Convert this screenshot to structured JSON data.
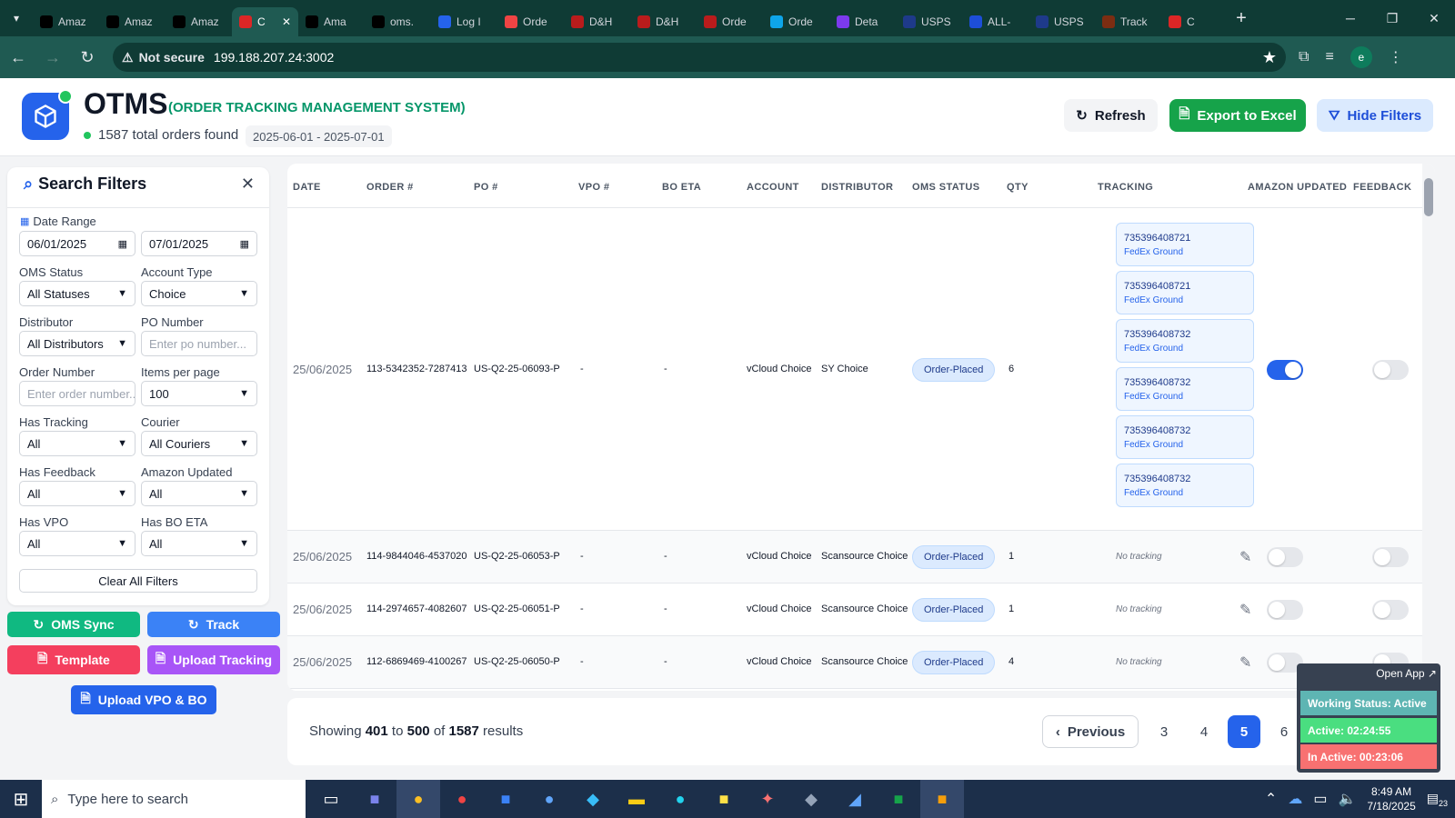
{
  "browser": {
    "tabs": [
      {
        "label": "Amaz",
        "icon": "amazon-icon",
        "color": "#000000"
      },
      {
        "label": "Amaz",
        "icon": "amazon-icon",
        "color": "#000000"
      },
      {
        "label": "Amaz",
        "icon": "amazon-icon",
        "color": "#000000"
      },
      {
        "label": "C",
        "icon": "otms-icon",
        "color": "#dc2626",
        "active": true
      },
      {
        "label": "Ama",
        "icon": "amazon-icon",
        "color": "#000000"
      },
      {
        "label": "oms.",
        "icon": "triangle-icon",
        "color": "#000000"
      },
      {
        "label": "Log I",
        "icon": "google-icon",
        "color": "#2563eb"
      },
      {
        "label": "Orde",
        "icon": "orders-icon",
        "color": "#ef4444"
      },
      {
        "label": "D&H",
        "icon": "dh-icon",
        "color": "#b91c1c"
      },
      {
        "label": "D&H",
        "icon": "dh-icon",
        "color": "#b91c1c"
      },
      {
        "label": "Orde",
        "icon": "dh-icon",
        "color": "#b91c1c"
      },
      {
        "label": "Orde",
        "icon": "ec-icon",
        "color": "#0ea5e9"
      },
      {
        "label": "Deta",
        "icon": "ingram-icon",
        "color": "#7c3aed"
      },
      {
        "label": "USPS",
        "icon": "usps-icon",
        "color": "#1e3a8a"
      },
      {
        "label": "ALL-",
        "icon": "17track-icon",
        "color": "#1d4ed8"
      },
      {
        "label": "USPS",
        "icon": "usps-icon",
        "color": "#1e3a8a"
      },
      {
        "label": "Track",
        "icon": "ups-icon",
        "color": "#7c2d12"
      },
      {
        "label": "C",
        "icon": "youtube-icon",
        "color": "#dc2626"
      }
    ],
    "not_secure": "Not secure",
    "url": "199.188.207.24:3002",
    "profile_initial": "e"
  },
  "header": {
    "title": "OTMS",
    "subtitle": "(ORDER TRACKING MANAGEMENT SYSTEM)",
    "orders_found": "1587 total orders found",
    "date_range": "2025-06-01 - 2025-07-01",
    "refresh": "Refresh",
    "export": "Export to Excel",
    "hide_filters": "Hide Filters"
  },
  "filters": {
    "title": "Search Filters",
    "date_range_label": "Date Range",
    "date_from": "06/01/2025",
    "date_to": "07/01/2025",
    "oms_status_label": "OMS Status",
    "oms_status": "All Statuses",
    "account_type_label": "Account Type",
    "account_type": "Choice",
    "distributor_label": "Distributor",
    "distributor": "All Distributors",
    "po_number_label": "PO Number",
    "po_number_placeholder": "Enter po number...",
    "order_number_label": "Order Number",
    "order_number_placeholder": "Enter order number...",
    "items_per_page_label": "Items per page",
    "items_per_page": "100",
    "has_tracking_label": "Has Tracking",
    "has_tracking": "All",
    "courier_label": "Courier",
    "courier": "All Couriers",
    "has_feedback_label": "Has Feedback",
    "has_feedback": "All",
    "amazon_updated_label": "Amazon Updated",
    "amazon_updated": "All",
    "has_vpo_label": "Has VPO",
    "has_vpo": "All",
    "has_bo_eta_label": "Has BO ETA",
    "has_bo_eta": "All",
    "clear": "Clear All Filters"
  },
  "actions": {
    "oms_sync": "OMS Sync",
    "track": "Track",
    "template": "Template",
    "upload_tracking": "Upload Tracking",
    "upload_vpo": "Upload VPO & BO"
  },
  "table": {
    "headers": [
      "DATE",
      "ORDER #",
      "PO #",
      "VPO #",
      "BO ETA",
      "ACCOUNT",
      "DISTRIBUTOR",
      "OMS STATUS",
      "QTY",
      "TRACKING",
      "AMAZON UPDATED",
      "FEEDBACK"
    ],
    "rows": [
      {
        "date": "25/06/2025",
        "order": "113-5342352-7287413",
        "po": "US-Q2-25-06093-P",
        "vpo": "-",
        "bo_eta": "-",
        "account": "vCloud Choice",
        "distributor": "SY Choice",
        "status": "Order-Placed",
        "qty": "6",
        "tracking": [
          {
            "number": "735396408721",
            "courier": "FedEx Ground"
          },
          {
            "number": "735396408721",
            "courier": "FedEx Ground"
          },
          {
            "number": "735396408732",
            "courier": "FedEx Ground"
          },
          {
            "number": "735396408732",
            "courier": "FedEx Ground"
          },
          {
            "number": "735396408732",
            "courier": "FedEx Ground"
          },
          {
            "number": "735396408732",
            "courier": "FedEx Ground"
          }
        ],
        "amazon_updated": true,
        "feedback": false
      },
      {
        "date": "25/06/2025",
        "order": "114-9844046-4537020",
        "po": "US-Q2-25-06053-P",
        "vpo": "-",
        "bo_eta": "-",
        "account": "vCloud Choice",
        "distributor": "Scansource Choice",
        "status": "Order-Placed",
        "qty": "1",
        "no_tracking": "No tracking",
        "amazon_updated": false,
        "feedback": false
      },
      {
        "date": "25/06/2025",
        "order": "114-2974657-4082607",
        "po": "US-Q2-25-06051-P",
        "vpo": "-",
        "bo_eta": "-",
        "account": "vCloud Choice",
        "distributor": "Scansource Choice",
        "status": "Order-Placed",
        "qty": "1",
        "no_tracking": "No tracking",
        "amazon_updated": false,
        "feedback": false
      },
      {
        "date": "25/06/2025",
        "order": "112-6869469-4100267",
        "po": "US-Q2-25-06050-P",
        "vpo": "-",
        "bo_eta": "-",
        "account": "vCloud Choice",
        "distributor": "Scansource Choice",
        "status": "Order-Placed",
        "qty": "4",
        "no_tracking": "No tracking",
        "amazon_updated": false,
        "feedback": false
      }
    ]
  },
  "pagination": {
    "showing": "Showing",
    "from": "401",
    "to_word": "to",
    "to": "500",
    "of_word": "of",
    "total": "1587",
    "results_word": "results",
    "previous": "Previous",
    "pages": [
      "3",
      "4",
      "5",
      "6"
    ],
    "current": "5"
  },
  "widget": {
    "open_app": "Open App ↗",
    "working_status": "Working Status: Active",
    "active": "Active: 02:24:55",
    "inactive": "In Active: 00:23:06"
  },
  "taskbar": {
    "search_placeholder": "Type here to search",
    "time": "8:49 AM",
    "date": "7/18/2025",
    "notifications": "23"
  },
  "colors": {
    "primary": "#2563eb",
    "success": "#16a34a",
    "teal": "#10b981",
    "pink": "#f43f5e",
    "purple": "#9333ea"
  }
}
